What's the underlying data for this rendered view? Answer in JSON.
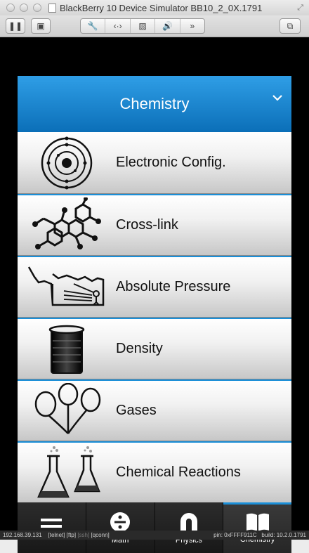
{
  "window": {
    "title": "BlackBerry 10 Device Simulator BB10_2_0X.1791"
  },
  "header": {
    "title": "Chemistry"
  },
  "items": [
    {
      "label": "Electronic Config.",
      "icon": "atom-icon"
    },
    {
      "label": "Cross-link",
      "icon": "molecule-icon"
    },
    {
      "label": "Absolute Pressure",
      "icon": "pressure-diagram-icon"
    },
    {
      "label": "Density",
      "icon": "beaker-icon"
    },
    {
      "label": "Gases",
      "icon": "balloons-icon"
    },
    {
      "label": "Chemical Reactions",
      "icon": "flasks-icon"
    }
  ],
  "tabs": [
    {
      "label": "",
      "icon": "menu-icon"
    },
    {
      "label": "Math",
      "icon": "divide-icon"
    },
    {
      "label": "Physics",
      "icon": "magnet-icon"
    },
    {
      "label": "Chemistry",
      "icon": "book-icon"
    }
  ],
  "status": {
    "ip": "192.168.39.131",
    "telnet": "[telnet]",
    "ftp": "[ftp]",
    "ssh": "[ssh]",
    "qconn": "[qconn]",
    "pin": "pin: 0xFFFF911C",
    "build": "build: 10.2.0.1791"
  },
  "colors": {
    "accent": "#1b8fd8",
    "header_top": "#2f9ee6",
    "header_bottom": "#0b6fb8"
  }
}
